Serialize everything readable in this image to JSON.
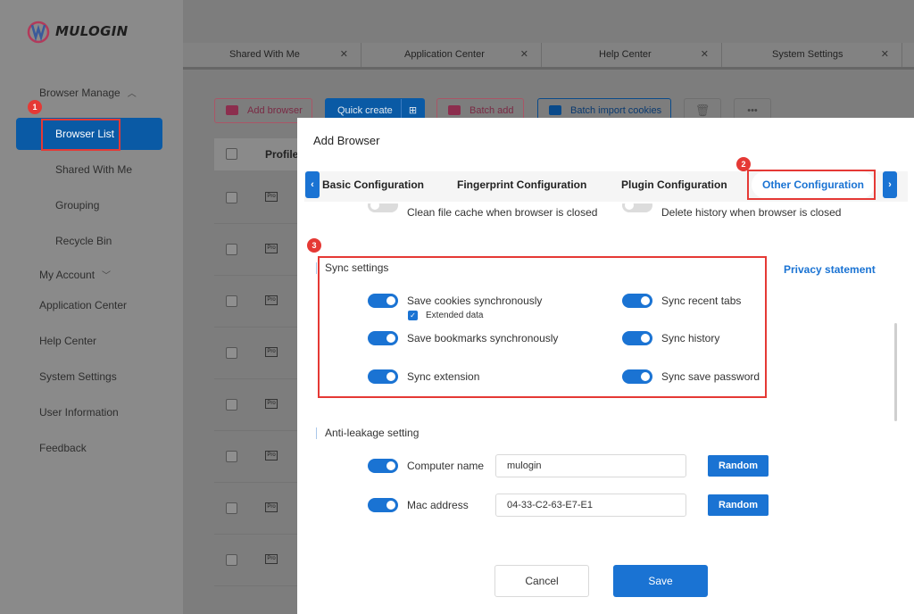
{
  "app": {
    "logo_text": "MULOGIN",
    "colors": {
      "brand_blue": "#1a73d3",
      "active_nav": "#0a5aa5",
      "annotation_red": "#e53935"
    }
  },
  "sidebar": {
    "items": [
      {
        "label": "Browser Manage",
        "level": 0,
        "chevron": "chevron-up-icon"
      },
      {
        "label": "Browser List",
        "level": 1,
        "active": true
      },
      {
        "label": "Shared With Me",
        "level": 1
      },
      {
        "label": "Grouping",
        "level": 1
      },
      {
        "label": "Recycle Bin",
        "level": 1
      },
      {
        "label": "My Account",
        "level": 0,
        "chevron": "chevron-down-icon"
      },
      {
        "label": "Application Center",
        "level": 0
      },
      {
        "label": "Help Center",
        "level": 0
      },
      {
        "label": "System Settings",
        "level": 0
      },
      {
        "label": "User Information",
        "level": 0
      },
      {
        "label": "Feedback",
        "level": 0
      }
    ]
  },
  "page_tabs": [
    {
      "label": "Shared With Me"
    },
    {
      "label": "Application Center"
    },
    {
      "label": "Help Center"
    },
    {
      "label": "System Settings"
    }
  ],
  "toolbar": {
    "add_browser": "Add browser",
    "quick_create": "Quick create",
    "batch_add": "Batch add",
    "batch_import_cookies": "Batch import cookies",
    "more": "•••"
  },
  "table": {
    "header_profile": "Profile",
    "pro_badge": "Pro"
  },
  "modal": {
    "title": "Add Browser",
    "tabs": [
      {
        "label": "Basic Configuration"
      },
      {
        "label": "Fingerprint Configuration"
      },
      {
        "label": "Plugin Configuration"
      },
      {
        "label": "Other Configuration",
        "active": true
      }
    ],
    "partial_options": {
      "clean_cache": "Clean file cache when browser is closed",
      "delete_history": "Delete history when browser is closed"
    },
    "sync": {
      "title": "Sync settings",
      "privacy_link": "Privacy statement",
      "save_cookies": "Save cookies synchronously",
      "extended_data": "Extended data",
      "sync_recent_tabs": "Sync recent tabs",
      "save_bookmarks": "Save bookmarks synchronously",
      "sync_history": "Sync history",
      "sync_extension": "Sync extension",
      "sync_save_password": "Sync save password"
    },
    "anti_leak": {
      "title": "Anti-leakage setting",
      "computer_name_label": "Computer name",
      "computer_name_value": "mulogin",
      "mac_label": "Mac address",
      "mac_value": "04-33-C2-63-E7-E1",
      "random": "Random"
    },
    "cancel": "Cancel",
    "save": "Save"
  },
  "annotations": {
    "n1": "1",
    "n2": "2",
    "n3": "3"
  }
}
